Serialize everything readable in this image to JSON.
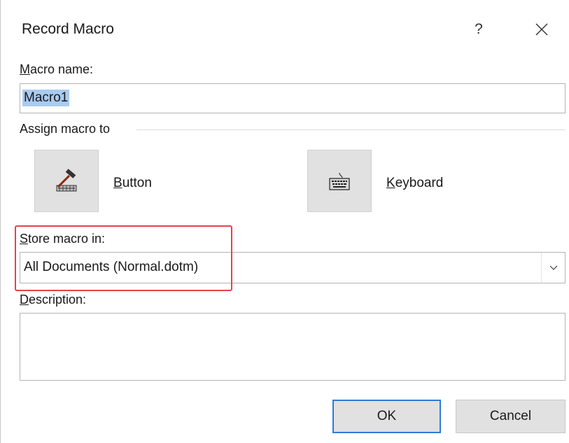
{
  "dialog": {
    "title": "Record Macro",
    "help_label": "?",
    "close_label": "×"
  },
  "macro_name": {
    "label": "Macro name:",
    "value": "Macro1"
  },
  "assign": {
    "label": "Assign macro to",
    "button_label": "Button",
    "button_icon": "hammer-icon",
    "keyboard_label": "Keyboard",
    "keyboard_icon": "keyboard-icon"
  },
  "store": {
    "label": "Store macro in:",
    "selected": "All Documents (Normal.dotm)",
    "highlight_color": "#e8424a"
  },
  "description": {
    "label": "Description:",
    "value": ""
  },
  "footer": {
    "ok_label": "OK",
    "cancel_label": "Cancel",
    "ok_border_color": "#2f7bd9"
  }
}
